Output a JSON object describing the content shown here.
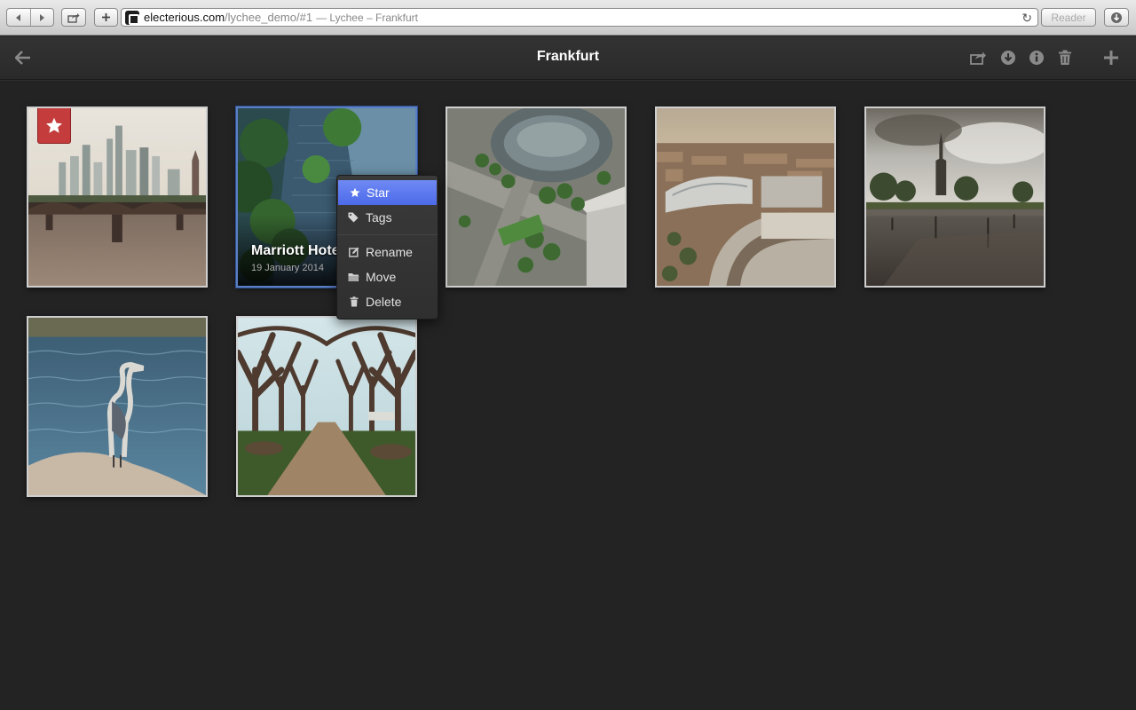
{
  "browser": {
    "url_domain": "electerious.com",
    "url_path": "/lychee_demo/#1",
    "url_title": "— Lychee – Frankfurt",
    "reader_label": "Reader"
  },
  "header": {
    "title": "Frankfurt"
  },
  "photos": [
    {
      "starred": true
    },
    {
      "title": "Marriott Hotel",
      "date": "19 January 2014",
      "selected": true
    },
    {},
    {},
    {},
    {},
    {}
  ],
  "context_menu": {
    "items": [
      {
        "label": "Star",
        "icon": "star-icon"
      },
      {
        "label": "Tags",
        "icon": "tag-icon"
      },
      {
        "label": "Rename",
        "icon": "edit-icon"
      },
      {
        "label": "Move",
        "icon": "folder-icon"
      },
      {
        "label": "Delete",
        "icon": "trash-icon"
      }
    ]
  },
  "colors": {
    "background": "#232323",
    "header": "#2e2e2e",
    "menu_highlight": "#5b78ee",
    "star_badge": "#c43c3c"
  }
}
